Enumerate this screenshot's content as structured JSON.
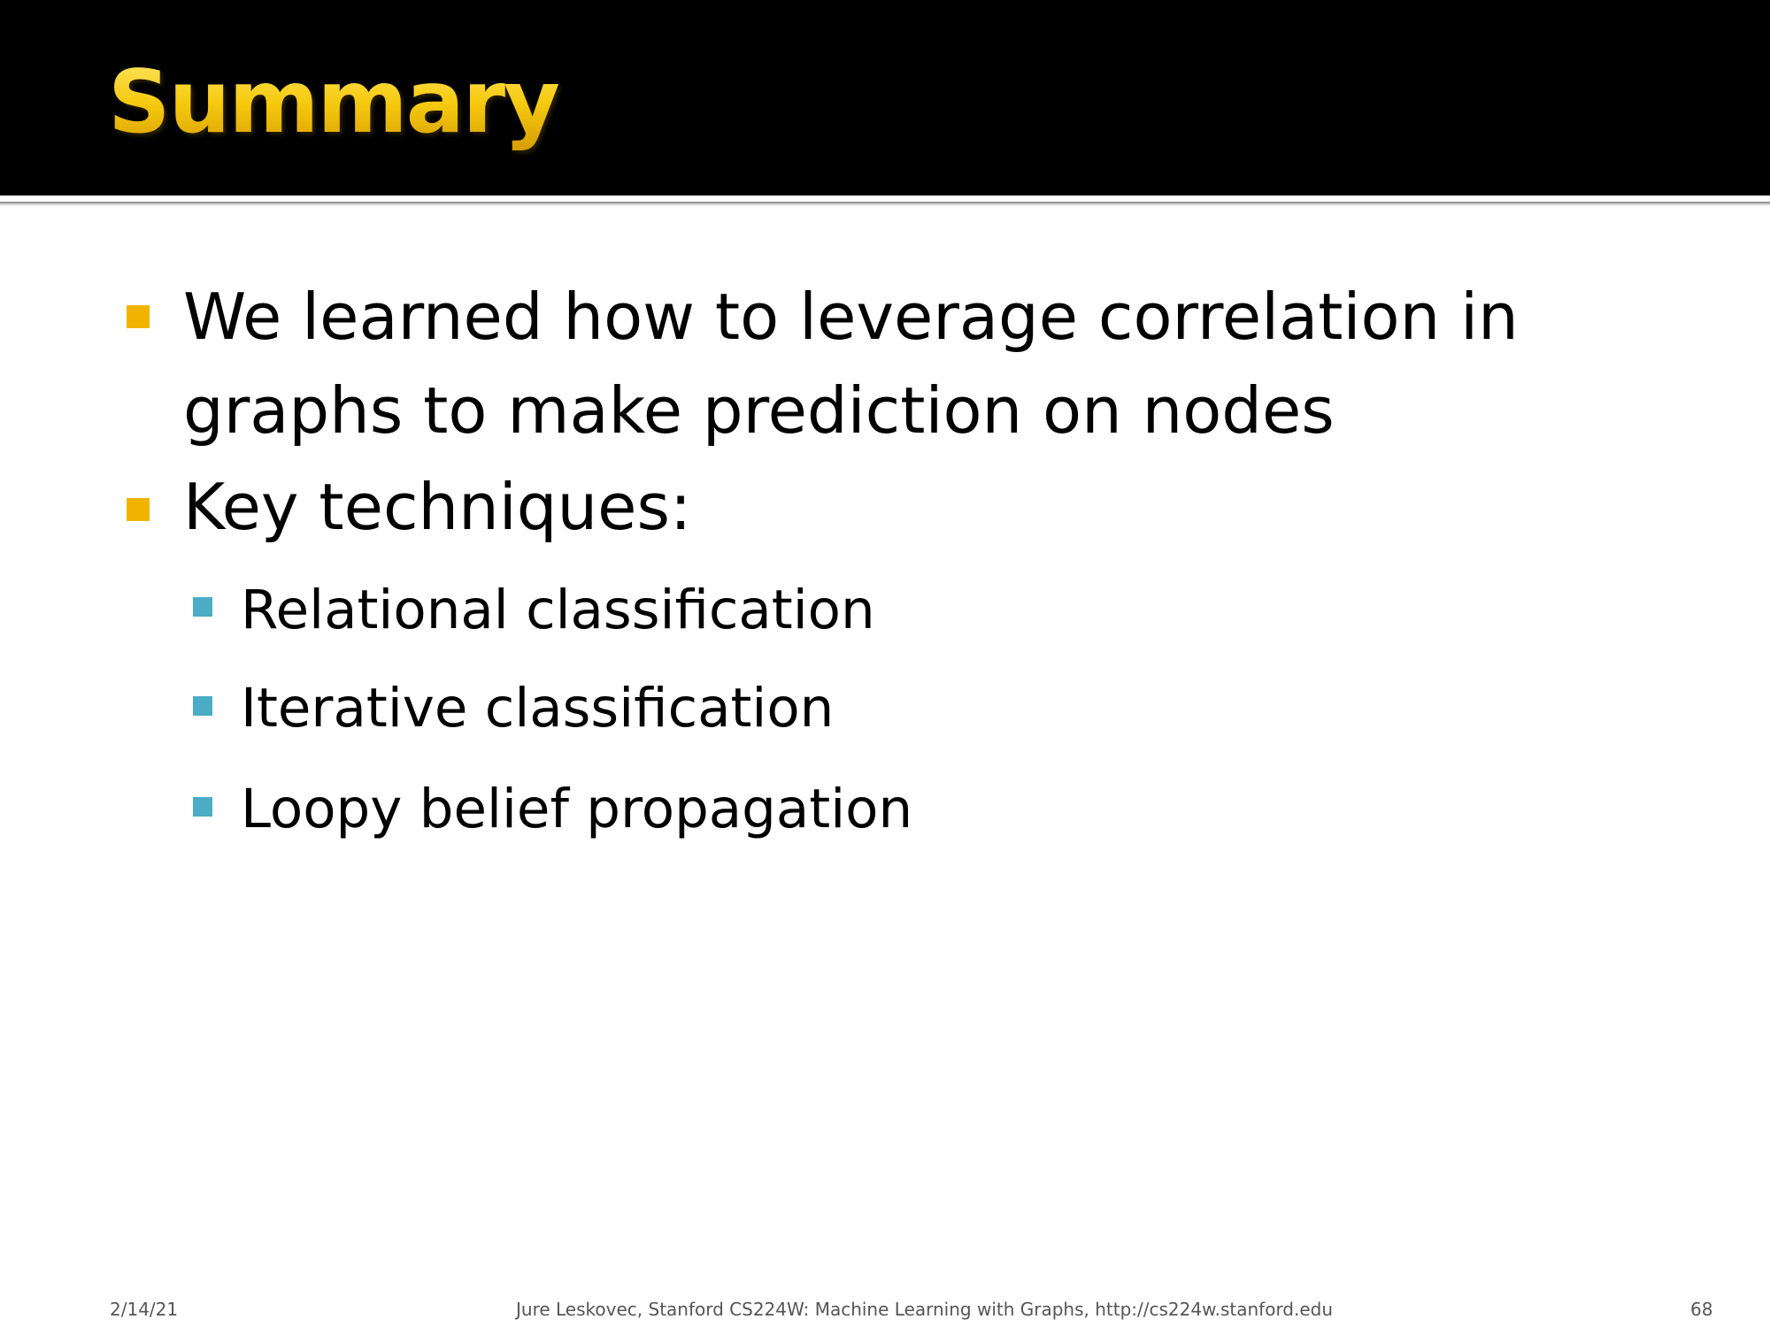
{
  "slide": {
    "title": "Summary",
    "bullets": [
      {
        "text": "We learned how to leverage correlation in graphs to make prediction on nodes"
      },
      {
        "text": "Key techniques:",
        "subitems": [
          "Relational classification",
          "Iterative classification",
          "Loopy belief propagation"
        ]
      }
    ]
  },
  "footer": {
    "date": "2/14/21",
    "credit": "Jure Leskovec, Stanford CS224W: Machine Learning with Graphs, http://cs224w.stanford.edu",
    "page_number": "68"
  },
  "colors": {
    "header_background": "#000000",
    "title_gold": "#f2c20d",
    "bullet_level1": "#f0b400",
    "bullet_level2": "#4bacc6"
  }
}
